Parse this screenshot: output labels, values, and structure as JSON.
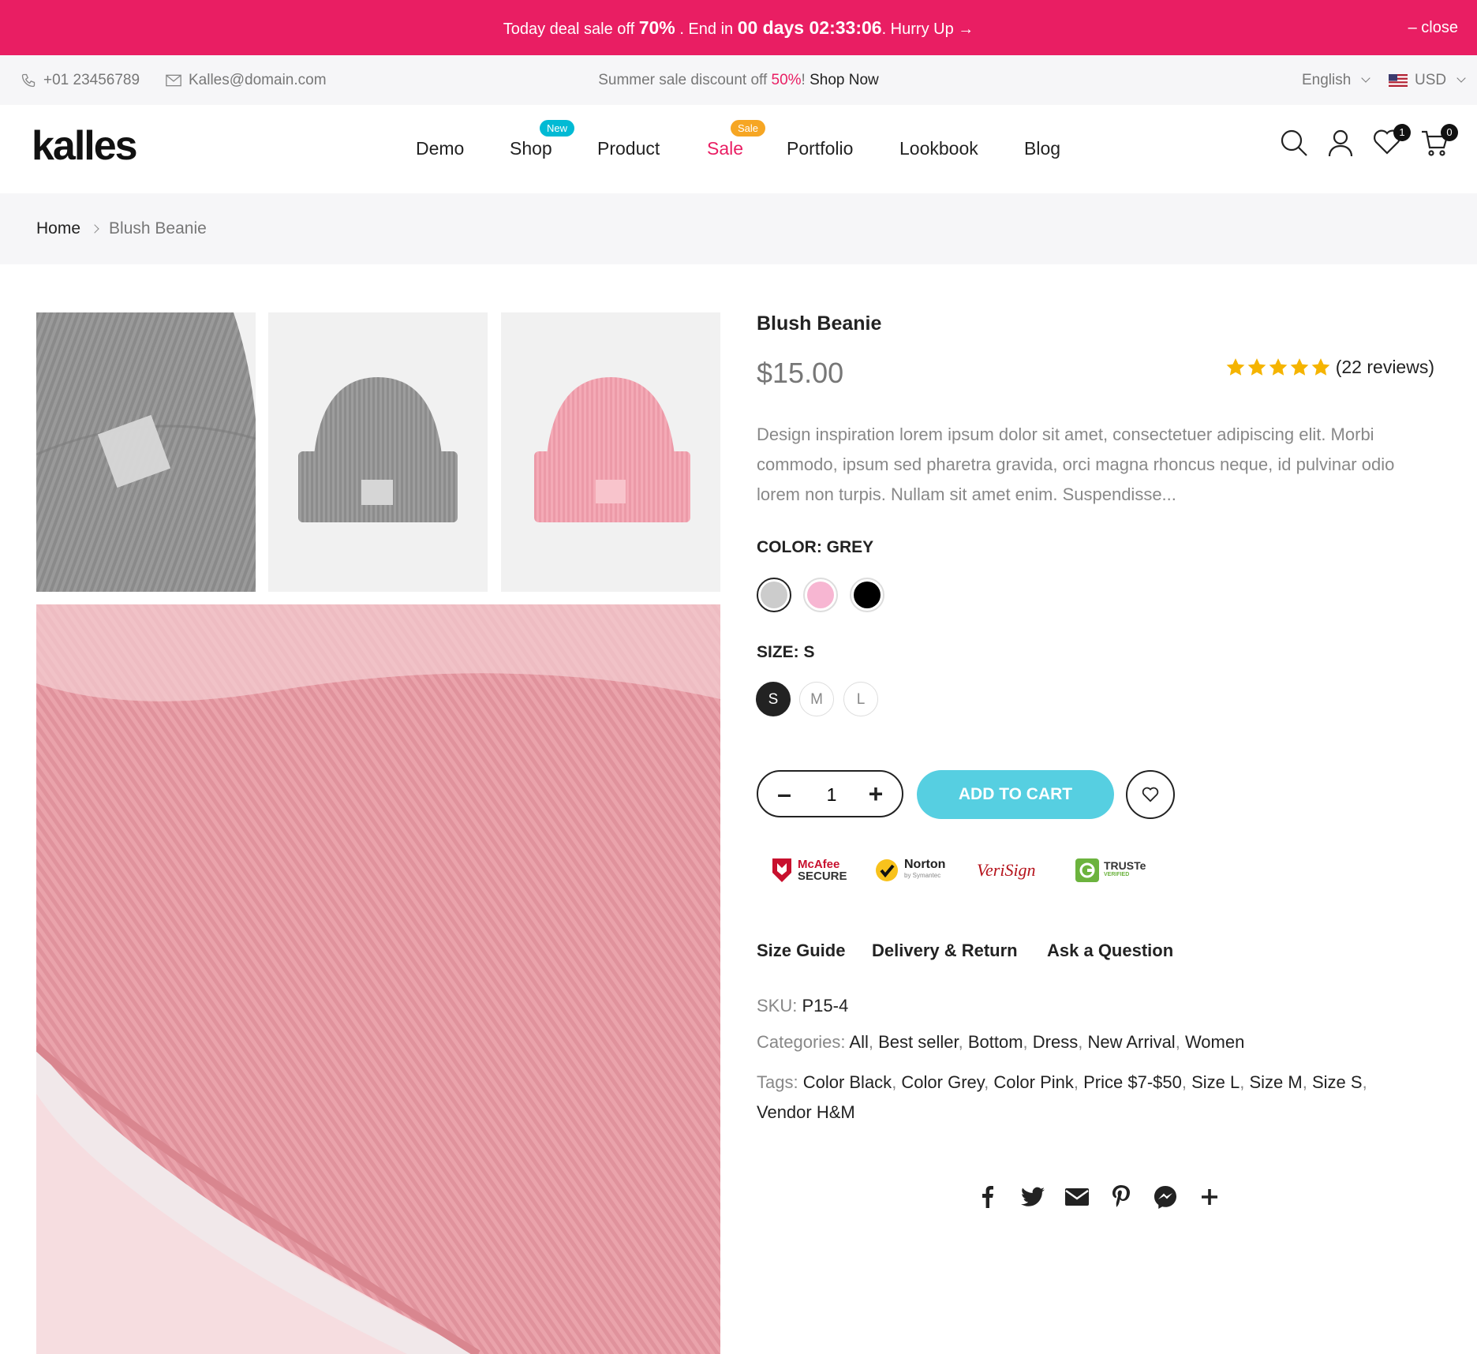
{
  "promo": {
    "pre": "Today deal sale off ",
    "percent": "70%",
    "mid": " . End in ",
    "countdown": "00 days 02:33:06",
    "post": ". Hurry Up →",
    "close": "– close"
  },
  "topbar": {
    "phone": "+01 23456789",
    "email": "Kalles@domain.com",
    "sale_pre": "Summer sale discount off ",
    "sale_pct": "50%",
    "sale_mid": "! ",
    "shop_now": "Shop Now",
    "language": "English",
    "currency": "USD"
  },
  "header": {
    "logo": "kalles",
    "nav": [
      {
        "label": "Demo"
      },
      {
        "label": "Shop",
        "badge": "New"
      },
      {
        "label": "Product"
      },
      {
        "label": "Sale",
        "badge": "Sale"
      },
      {
        "label": "Portfolio"
      },
      {
        "label": "Lookbook"
      },
      {
        "label": "Blog"
      }
    ],
    "wishlist_count": "1",
    "cart_count": "0"
  },
  "breadcrumb": {
    "home": "Home",
    "current": "Blush Beanie"
  },
  "product": {
    "title": "Blush Beanie",
    "price": "$15.00",
    "reviews": "(22 reviews)",
    "rating": 5,
    "description": "Design inspiration lorem ipsum dolor sit amet, consectetuer adipiscing elit. Morbi commodo, ipsum sed pharetra gravida, orci magna rhoncus neque, id pulvinar odio lorem non turpis. Nullam sit amet enim. Suspendisse...",
    "color_label": "COLOR: ",
    "color_value": "GREY",
    "colors": [
      "#cccccc",
      "#f7b6d2",
      "#000000"
    ],
    "size_label": "SIZE: ",
    "size_value": "S",
    "sizes": [
      "S",
      "M",
      "L"
    ],
    "quantity": "1",
    "add_to_cart": "ADD TO CART",
    "trust": {
      "mcafee_1": "McAfee",
      "mcafee_2": "SECURE",
      "norton": "Norton",
      "norton_sub": "by Symantec",
      "verisign": "VeriSign",
      "truste": "TRUSTe",
      "truste_sub": "VERIFIED"
    },
    "links": [
      "Size Guide",
      "Delivery & Return",
      "Ask a Question"
    ],
    "sku_label": "SKU: ",
    "sku": "P15-4",
    "categories_label": "Categories: ",
    "categories": [
      "All",
      "Best seller",
      "Bottom",
      "Dress",
      "New Arrival",
      "Women"
    ],
    "tags_label": "Tags: ",
    "tags": [
      "Color Black",
      "Color Grey",
      "Color Pink",
      "Price $7-$50",
      "Size L",
      "Size M",
      "Size S",
      "Vendor H&M"
    ]
  },
  "colors": {
    "accent": "#e91e63",
    "cart": "#56cfe1",
    "new_badge": "#01bad4",
    "sale_badge": "#f6a623"
  }
}
